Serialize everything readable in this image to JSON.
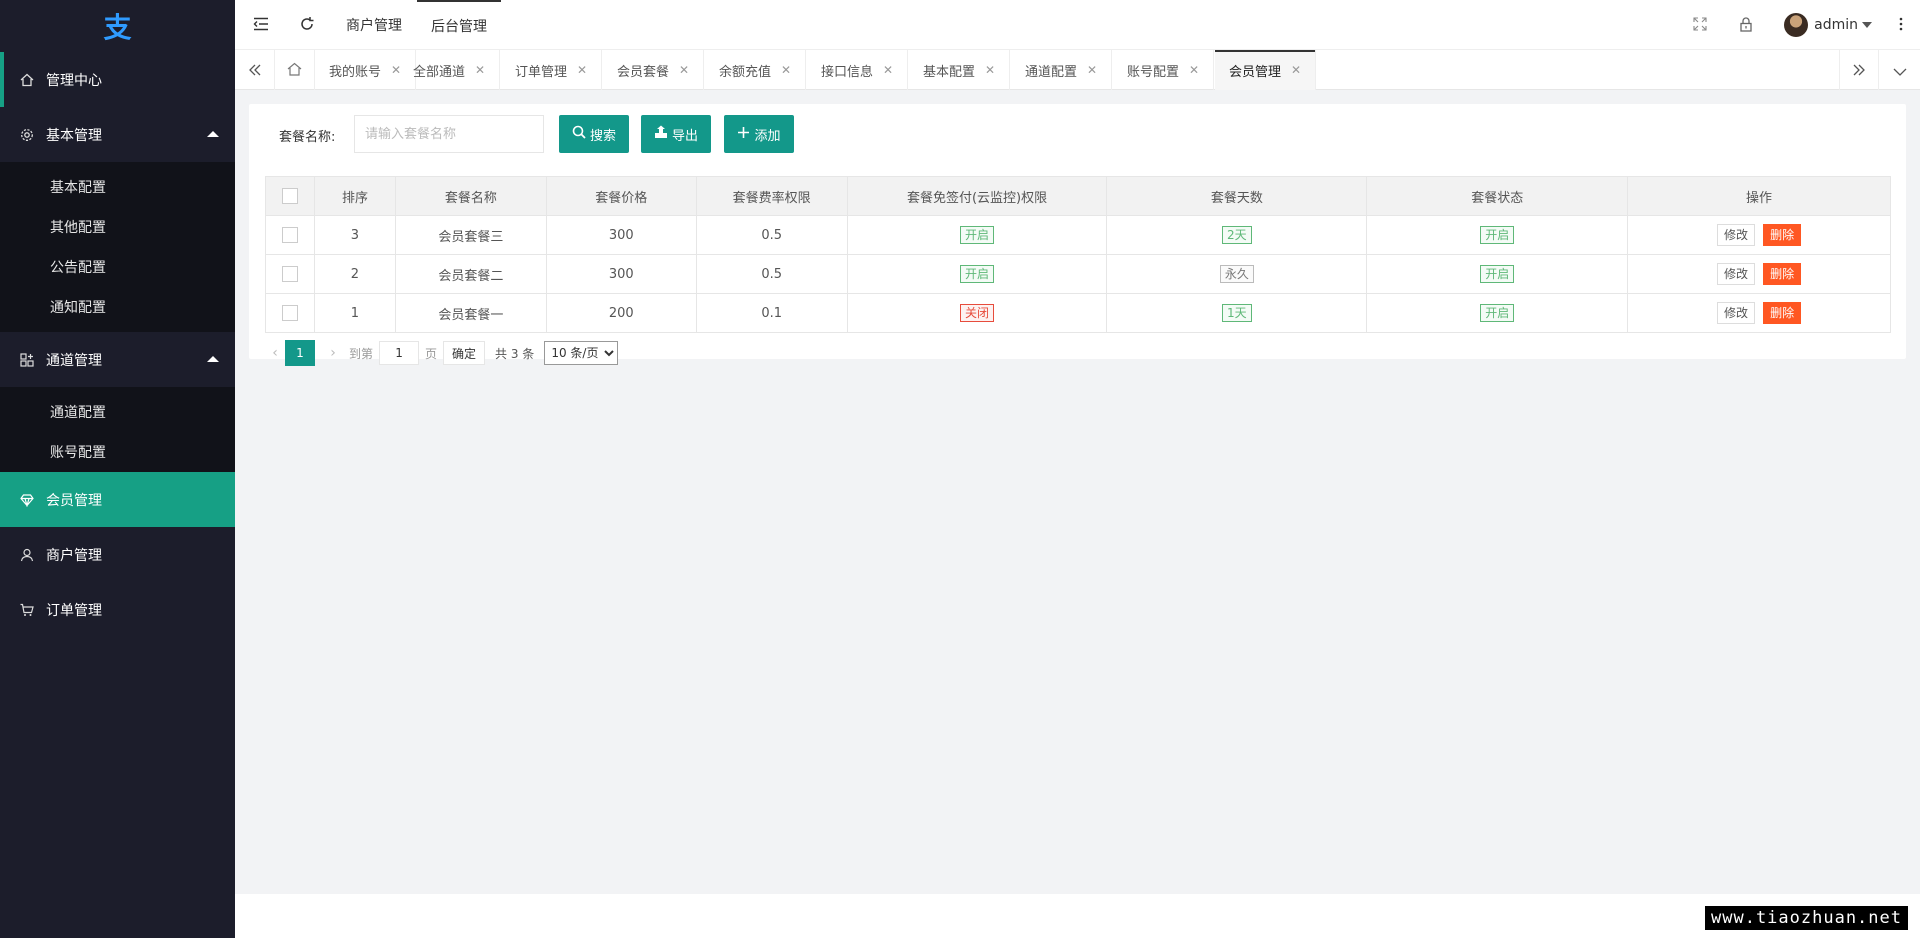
{
  "sidebar": {
    "logo": "支",
    "items": [
      {
        "label": "管理中心",
        "icon": "home-icon"
      },
      {
        "label": "基本管理",
        "icon": "gear-icon",
        "children": [
          "基本配置",
          "其他配置",
          "公告配置",
          "通知配置"
        ]
      },
      {
        "label": "通道管理",
        "icon": "apps-icon",
        "children": [
          "通道配置",
          "账号配置"
        ]
      },
      {
        "label": "会员管理",
        "icon": "diamond-icon"
      },
      {
        "label": "商户管理",
        "icon": "user-icon"
      },
      {
        "label": "订单管理",
        "icon": "cart-icon"
      }
    ]
  },
  "header": {
    "menus": [
      "商户管理",
      "后台管理"
    ],
    "user": "admin"
  },
  "tabs": [
    "我的账号",
    "全部通道",
    "订单管理",
    "会员套餐",
    "余额充值",
    "接口信息",
    "基本配置",
    "通道配置",
    "账号配置",
    "会员管理"
  ],
  "search": {
    "label": "套餐名称:",
    "placeholder": "请输入套餐名称",
    "search_btn": "搜索",
    "export_btn": "导出",
    "add_btn": "添加"
  },
  "table": {
    "headers": [
      "排序",
      "套餐名称",
      "套餐价格",
      "套餐费率权限",
      "套餐免签付(云监控)权限",
      "套餐天数",
      "套餐状态",
      "操作"
    ],
    "rows": [
      {
        "sort": "3",
        "name": "会员套餐三",
        "price": "300",
        "rate": "0.5",
        "free": "开启",
        "days": "2天",
        "status": "开启"
      },
      {
        "sort": "2",
        "name": "会员套餐二",
        "price": "300",
        "rate": "0.5",
        "free": "开启",
        "days": "永久",
        "status": "开启"
      },
      {
        "sort": "1",
        "name": "会员套餐一",
        "price": "200",
        "rate": "0.1",
        "free": "关闭",
        "days": "1天",
        "status": "开启"
      }
    ],
    "edit_label": "修改",
    "delete_label": "删除"
  },
  "pager": {
    "current": "1",
    "goto_label": "到第",
    "page_label": "页",
    "goto_value": "1",
    "confirm": "确定",
    "total": "共 3 条",
    "page_size": "10 条/页"
  },
  "watermark": "www.tiaozhuan.net",
  "colors": {
    "accent": "#13988a",
    "sidebar": "#1c1d2b",
    "danger": "#ff5722"
  }
}
